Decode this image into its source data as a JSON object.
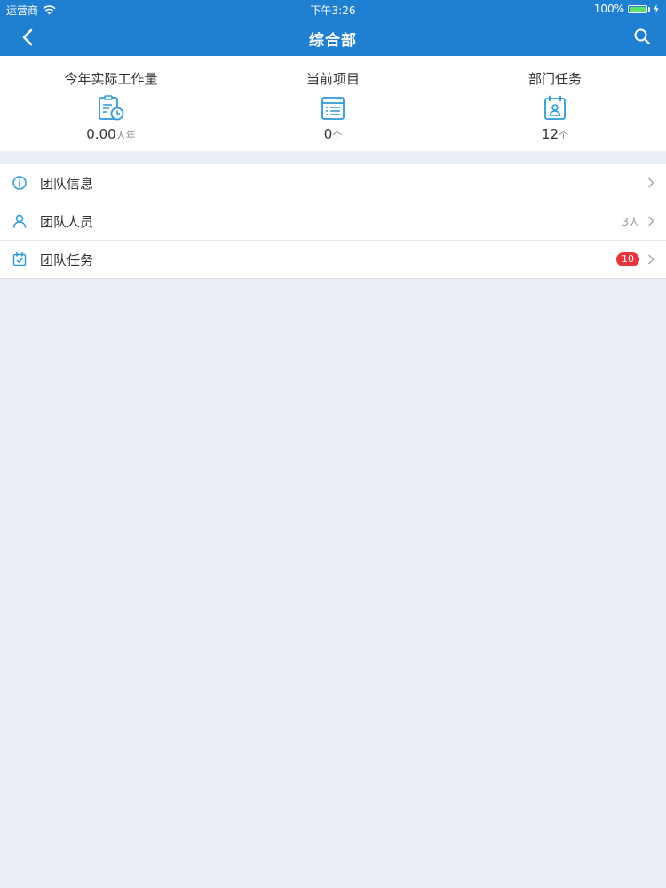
{
  "status_bar": {
    "carrier": "运营商",
    "time": "下午3:26",
    "battery_percent": "100%"
  },
  "navbar": {
    "title": "综合部",
    "back_icon": "chevron-left-icon",
    "search_icon": "search-icon"
  },
  "stats": [
    {
      "label": "今年实际工作量",
      "value": "0.00",
      "unit": "人年",
      "icon": "clipboard-clock-icon"
    },
    {
      "label": "当前项目",
      "value": "0",
      "unit": "个",
      "icon": "list-board-icon"
    },
    {
      "label": "部门任务",
      "value": "12",
      "unit": "个",
      "icon": "calendar-person-icon"
    }
  ],
  "menu": [
    {
      "label": "团队信息",
      "meta": "",
      "badge": "",
      "icon": "info-circle-icon"
    },
    {
      "label": "团队人员",
      "meta": "3人",
      "badge": "",
      "icon": "person-icon"
    },
    {
      "label": "团队任务",
      "meta": "",
      "badge": "10",
      "icon": "calendar-check-icon"
    }
  ],
  "colors": {
    "primary": "#1f7fd1",
    "icon_blue": "#2b9ad6",
    "badge_red": "#e8353b",
    "background": "#eaeff5"
  }
}
